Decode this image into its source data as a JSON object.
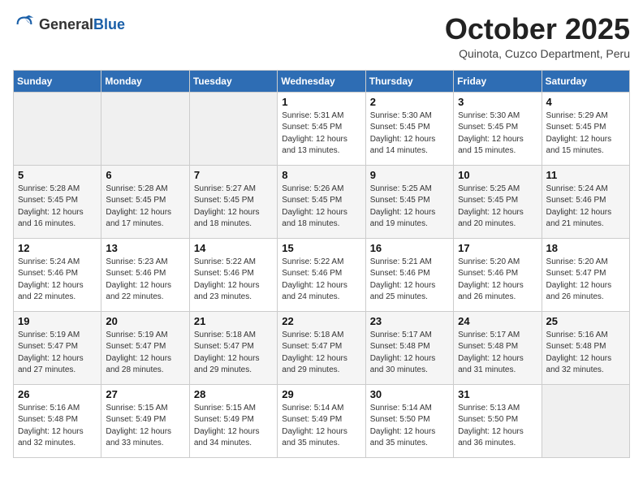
{
  "header": {
    "logo": {
      "general": "General",
      "blue": "Blue"
    },
    "title": "October 2025",
    "subtitle": "Quinota, Cuzco Department, Peru"
  },
  "weekdays": [
    "Sunday",
    "Monday",
    "Tuesday",
    "Wednesday",
    "Thursday",
    "Friday",
    "Saturday"
  ],
  "weeks": [
    [
      {
        "day": "",
        "empty": true
      },
      {
        "day": "",
        "empty": true
      },
      {
        "day": "",
        "empty": true
      },
      {
        "day": "1",
        "sunrise": "5:31 AM",
        "sunset": "5:45 PM",
        "daylight": "12 hours and 13 minutes."
      },
      {
        "day": "2",
        "sunrise": "5:30 AM",
        "sunset": "5:45 PM",
        "daylight": "12 hours and 14 minutes."
      },
      {
        "day": "3",
        "sunrise": "5:30 AM",
        "sunset": "5:45 PM",
        "daylight": "12 hours and 15 minutes."
      },
      {
        "day": "4",
        "sunrise": "5:29 AM",
        "sunset": "5:45 PM",
        "daylight": "12 hours and 15 minutes."
      }
    ],
    [
      {
        "day": "5",
        "sunrise": "5:28 AM",
        "sunset": "5:45 PM",
        "daylight": "12 hours and 16 minutes."
      },
      {
        "day": "6",
        "sunrise": "5:28 AM",
        "sunset": "5:45 PM",
        "daylight": "12 hours and 17 minutes."
      },
      {
        "day": "7",
        "sunrise": "5:27 AM",
        "sunset": "5:45 PM",
        "daylight": "12 hours and 18 minutes."
      },
      {
        "day": "8",
        "sunrise": "5:26 AM",
        "sunset": "5:45 PM",
        "daylight": "12 hours and 18 minutes."
      },
      {
        "day": "9",
        "sunrise": "5:25 AM",
        "sunset": "5:45 PM",
        "daylight": "12 hours and 19 minutes."
      },
      {
        "day": "10",
        "sunrise": "5:25 AM",
        "sunset": "5:45 PM",
        "daylight": "12 hours and 20 minutes."
      },
      {
        "day": "11",
        "sunrise": "5:24 AM",
        "sunset": "5:46 PM",
        "daylight": "12 hours and 21 minutes."
      }
    ],
    [
      {
        "day": "12",
        "sunrise": "5:24 AM",
        "sunset": "5:46 PM",
        "daylight": "12 hours and 22 minutes."
      },
      {
        "day": "13",
        "sunrise": "5:23 AM",
        "sunset": "5:46 PM",
        "daylight": "12 hours and 22 minutes."
      },
      {
        "day": "14",
        "sunrise": "5:22 AM",
        "sunset": "5:46 PM",
        "daylight": "12 hours and 23 minutes."
      },
      {
        "day": "15",
        "sunrise": "5:22 AM",
        "sunset": "5:46 PM",
        "daylight": "12 hours and 24 minutes."
      },
      {
        "day": "16",
        "sunrise": "5:21 AM",
        "sunset": "5:46 PM",
        "daylight": "12 hours and 25 minutes."
      },
      {
        "day": "17",
        "sunrise": "5:20 AM",
        "sunset": "5:46 PM",
        "daylight": "12 hours and 26 minutes."
      },
      {
        "day": "18",
        "sunrise": "5:20 AM",
        "sunset": "5:47 PM",
        "daylight": "12 hours and 26 minutes."
      }
    ],
    [
      {
        "day": "19",
        "sunrise": "5:19 AM",
        "sunset": "5:47 PM",
        "daylight": "12 hours and 27 minutes."
      },
      {
        "day": "20",
        "sunrise": "5:19 AM",
        "sunset": "5:47 PM",
        "daylight": "12 hours and 28 minutes."
      },
      {
        "day": "21",
        "sunrise": "5:18 AM",
        "sunset": "5:47 PM",
        "daylight": "12 hours and 29 minutes."
      },
      {
        "day": "22",
        "sunrise": "5:18 AM",
        "sunset": "5:47 PM",
        "daylight": "12 hours and 29 minutes."
      },
      {
        "day": "23",
        "sunrise": "5:17 AM",
        "sunset": "5:48 PM",
        "daylight": "12 hours and 30 minutes."
      },
      {
        "day": "24",
        "sunrise": "5:17 AM",
        "sunset": "5:48 PM",
        "daylight": "12 hours and 31 minutes."
      },
      {
        "day": "25",
        "sunrise": "5:16 AM",
        "sunset": "5:48 PM",
        "daylight": "12 hours and 32 minutes."
      }
    ],
    [
      {
        "day": "26",
        "sunrise": "5:16 AM",
        "sunset": "5:48 PM",
        "daylight": "12 hours and 32 minutes."
      },
      {
        "day": "27",
        "sunrise": "5:15 AM",
        "sunset": "5:49 PM",
        "daylight": "12 hours and 33 minutes."
      },
      {
        "day": "28",
        "sunrise": "5:15 AM",
        "sunset": "5:49 PM",
        "daylight": "12 hours and 34 minutes."
      },
      {
        "day": "29",
        "sunrise": "5:14 AM",
        "sunset": "5:49 PM",
        "daylight": "12 hours and 35 minutes."
      },
      {
        "day": "30",
        "sunrise": "5:14 AM",
        "sunset": "5:50 PM",
        "daylight": "12 hours and 35 minutes."
      },
      {
        "day": "31",
        "sunrise": "5:13 AM",
        "sunset": "5:50 PM",
        "daylight": "12 hours and 36 minutes."
      },
      {
        "day": "",
        "empty": true
      }
    ]
  ]
}
